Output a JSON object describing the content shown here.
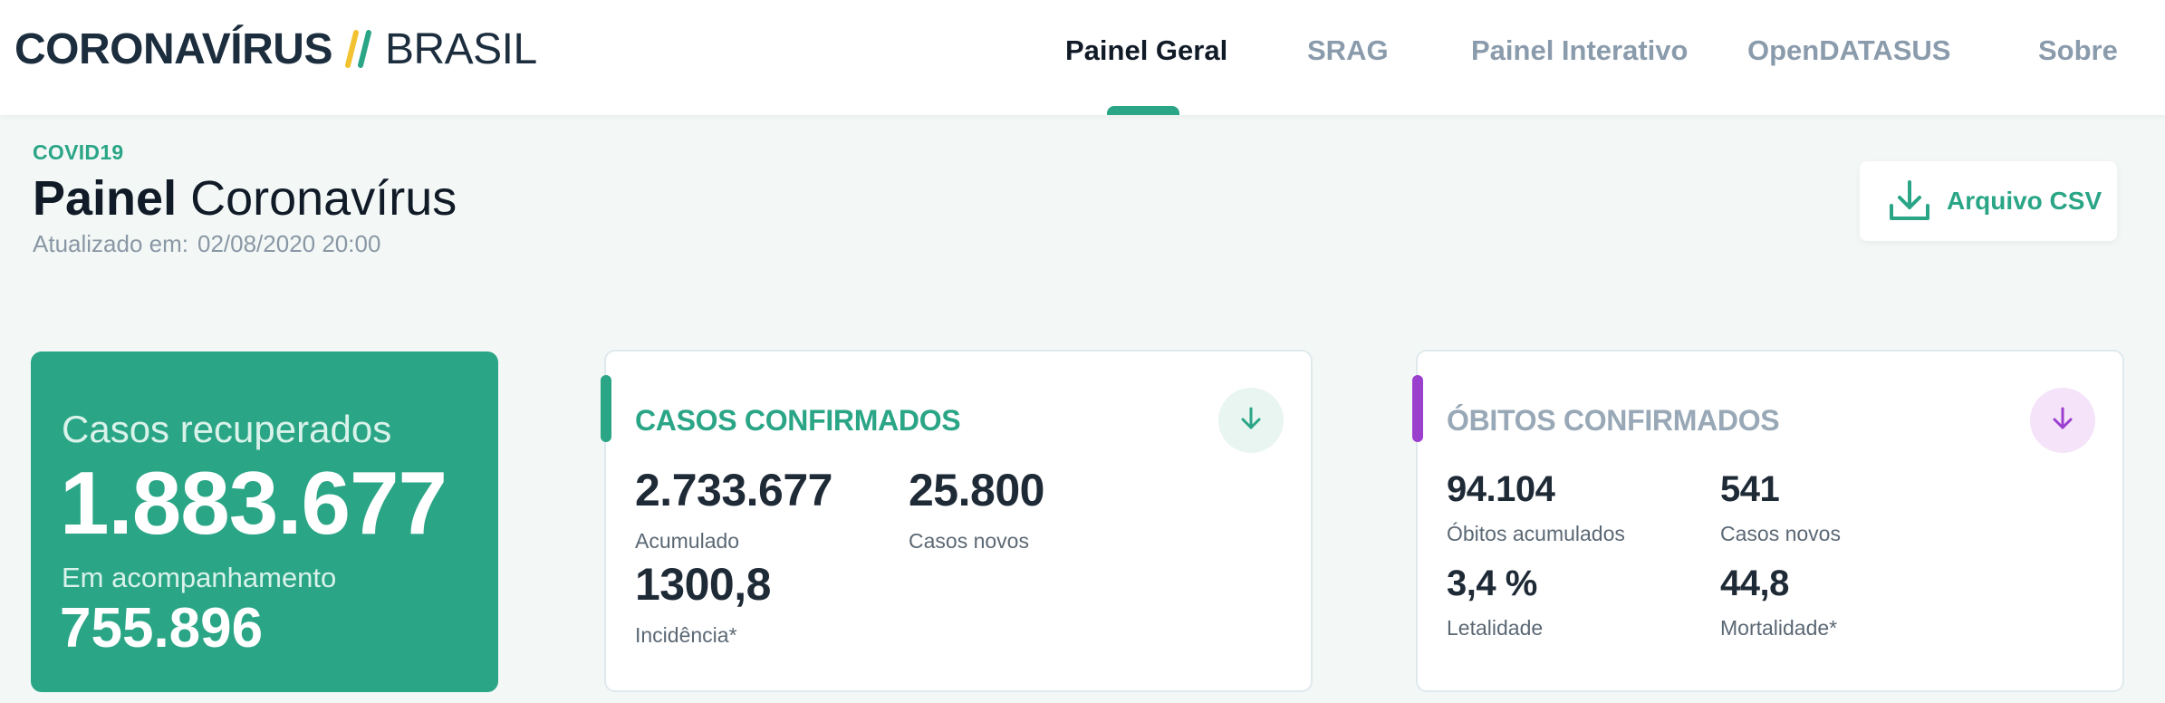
{
  "header": {
    "logo": {
      "main": "CORONAVÍRUS",
      "separator": "//",
      "country": "BRASIL"
    },
    "nav": [
      {
        "label": "Painel Geral",
        "active": true
      },
      {
        "label": "SRAG",
        "active": false
      },
      {
        "label": "Painel Interativo",
        "active": false
      },
      {
        "label": "OpenDATASUS",
        "active": false
      },
      {
        "label": "Sobre",
        "active": false
      }
    ]
  },
  "page": {
    "eyebrow": "COVID19",
    "title_strong": "Painel",
    "title_rest": "Coronavírus",
    "updated_label": "Atualizado em:",
    "updated_value": "02/08/2020 20:00",
    "csv_button": {
      "label": "Arquivo CSV",
      "icon": "download-icon"
    }
  },
  "recovered": {
    "title": "Casos recuperados",
    "value": "1.883.677",
    "sub_label": "Em acompanhamento",
    "sub_value": "755.896"
  },
  "cases": {
    "title": "CASOS CONFIRMADOS",
    "toggle_icon": "arrow-down-icon",
    "accumulated_value": "2.733.677",
    "accumulated_label": "Acumulado",
    "new_value": "25.800",
    "new_label": "Casos novos",
    "incidence_value": "1300,8",
    "incidence_label": "Incidência*"
  },
  "deaths": {
    "title": "ÓBITOS CONFIRMADOS",
    "toggle_icon": "arrow-down-icon",
    "accumulated_value": "94.104",
    "accumulated_label": "Óbitos acumulados",
    "new_value": "541",
    "new_label": "Casos novos",
    "lethality_value": "3,4 %",
    "lethality_label": "Letalidade",
    "mortality_value": "44,8",
    "mortality_label": "Mortalidade*"
  },
  "colors": {
    "accent_green": "#2aa586",
    "accent_purple": "#9b3fcf",
    "logo_yellow": "#f2c230",
    "logo_green": "#2aa586",
    "text_dark": "#1f2a37",
    "background": "#f3f8f7"
  }
}
